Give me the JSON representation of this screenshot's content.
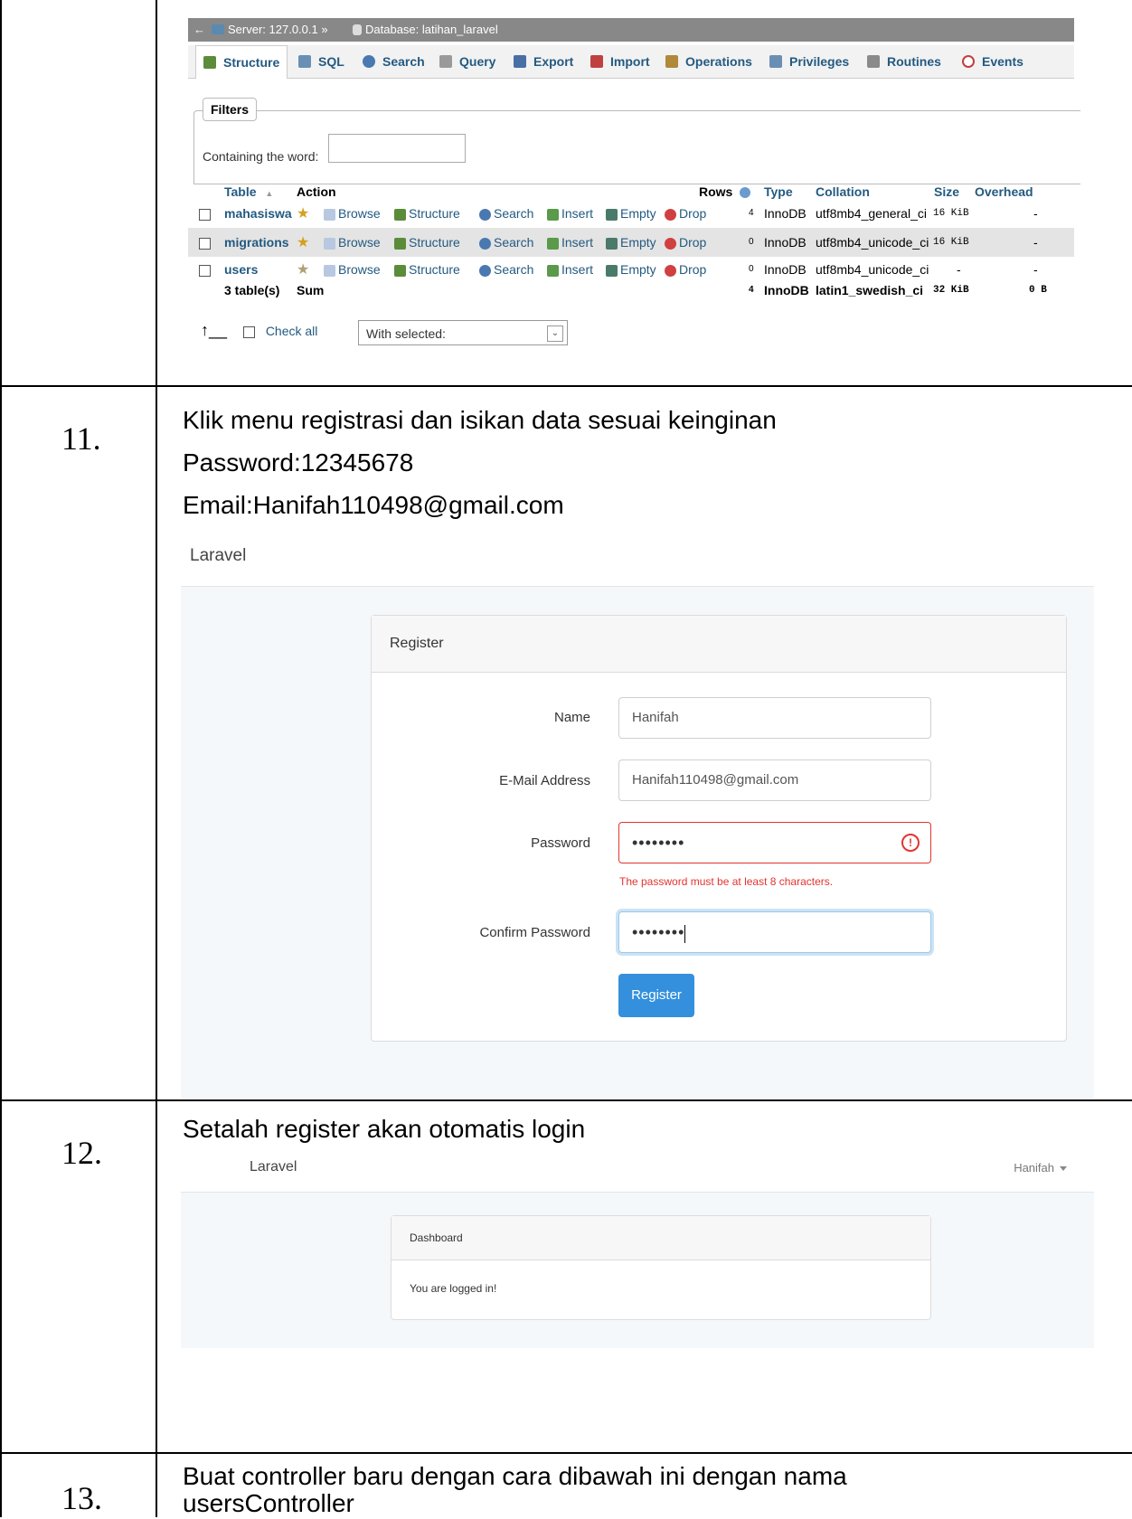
{
  "rows": [
    {
      "number": "11.",
      "lines": [
        "Klik menu registrasi dan isikan data sesuai keinginan",
        "Password:12345678",
        "Email:Hanifah110498@gmail.com"
      ]
    },
    {
      "number": "12.",
      "lines": [
        "Setalah register akan otomatis login"
      ]
    },
    {
      "number": "13.",
      "lines": [
        "Buat controller baru dengan cara dibawah ini dengan nama",
        "usersController"
      ]
    }
  ],
  "pma": {
    "breadcrumb": {
      "server": "Server: 127.0.0.1 »",
      "database": "Database: latihan_laravel"
    },
    "tabs": [
      {
        "label": "Structure",
        "icon": "structure-icon",
        "color": "#5b8c3a"
      },
      {
        "label": "SQL",
        "icon": "sql-icon",
        "color": "#6a8fb5"
      },
      {
        "label": "Search",
        "icon": "search-icon",
        "color": "#4a78b0"
      },
      {
        "label": "Query",
        "icon": "query-icon",
        "color": "#9a9a9a"
      },
      {
        "label": "Export",
        "icon": "export-icon",
        "color": "#4a6fa5"
      },
      {
        "label": "Import",
        "icon": "import-icon",
        "color": "#c04040"
      },
      {
        "label": "Operations",
        "icon": "wrench-icon",
        "color": "#b08a3a"
      },
      {
        "label": "Privileges",
        "icon": "privileges-icon",
        "color": "#6a8fb5"
      },
      {
        "label": "Routines",
        "icon": "routines-icon",
        "color": "#8a8a8a"
      },
      {
        "label": "Events",
        "icon": "clock-icon",
        "color": "#c04040"
      }
    ],
    "filters_legend": "Filters",
    "containing_label": "Containing the word:",
    "headers": {
      "table": "Table",
      "action": "Action",
      "rows": "Rows",
      "type": "Type",
      "collation": "Collation",
      "size": "Size",
      "overhead": "Overhead"
    },
    "actions": {
      "browse": "Browse",
      "structure": "Structure",
      "search": "Search",
      "insert": "Insert",
      "empty": "Empty",
      "drop": "Drop"
    },
    "tables": [
      {
        "name": "mahasiswa",
        "rows": "4",
        "type": "InnoDB",
        "collation": "utf8mb4_general_ci",
        "size": "16 KiB",
        "overhead": "-"
      },
      {
        "name": "migrations",
        "rows": "0",
        "type": "InnoDB",
        "collation": "utf8mb4_unicode_ci",
        "size": "16 KiB",
        "overhead": "-"
      },
      {
        "name": "users",
        "rows": "0",
        "type": "InnoDB",
        "collation": "utf8mb4_unicode_ci",
        "size": "-",
        "overhead": "-"
      }
    ],
    "sum": {
      "count": "3 table(s)",
      "label": "Sum",
      "rows": "4",
      "type": "InnoDB",
      "collation": "latin1_swedish_ci",
      "size": "32 KiB",
      "overhead": "0 B"
    },
    "check_all": "Check all",
    "with_selected": "With selected:"
  },
  "register": {
    "brand": "Laravel",
    "card_title": "Register",
    "fields": {
      "name_label": "Name",
      "name_value": "Hanifah",
      "email_label": "E-Mail Address",
      "email_value": "Hanifah110498@gmail.com",
      "password_label": "Password",
      "password_value": "••••••••",
      "password_error": "The password must be at least 8 characters.",
      "confirm_label": "Confirm Password",
      "confirm_value": "••••••••"
    },
    "button": "Register"
  },
  "dashboard": {
    "brand": "Laravel",
    "user": "Hanifah",
    "card_title": "Dashboard",
    "message": "You are logged in!"
  }
}
